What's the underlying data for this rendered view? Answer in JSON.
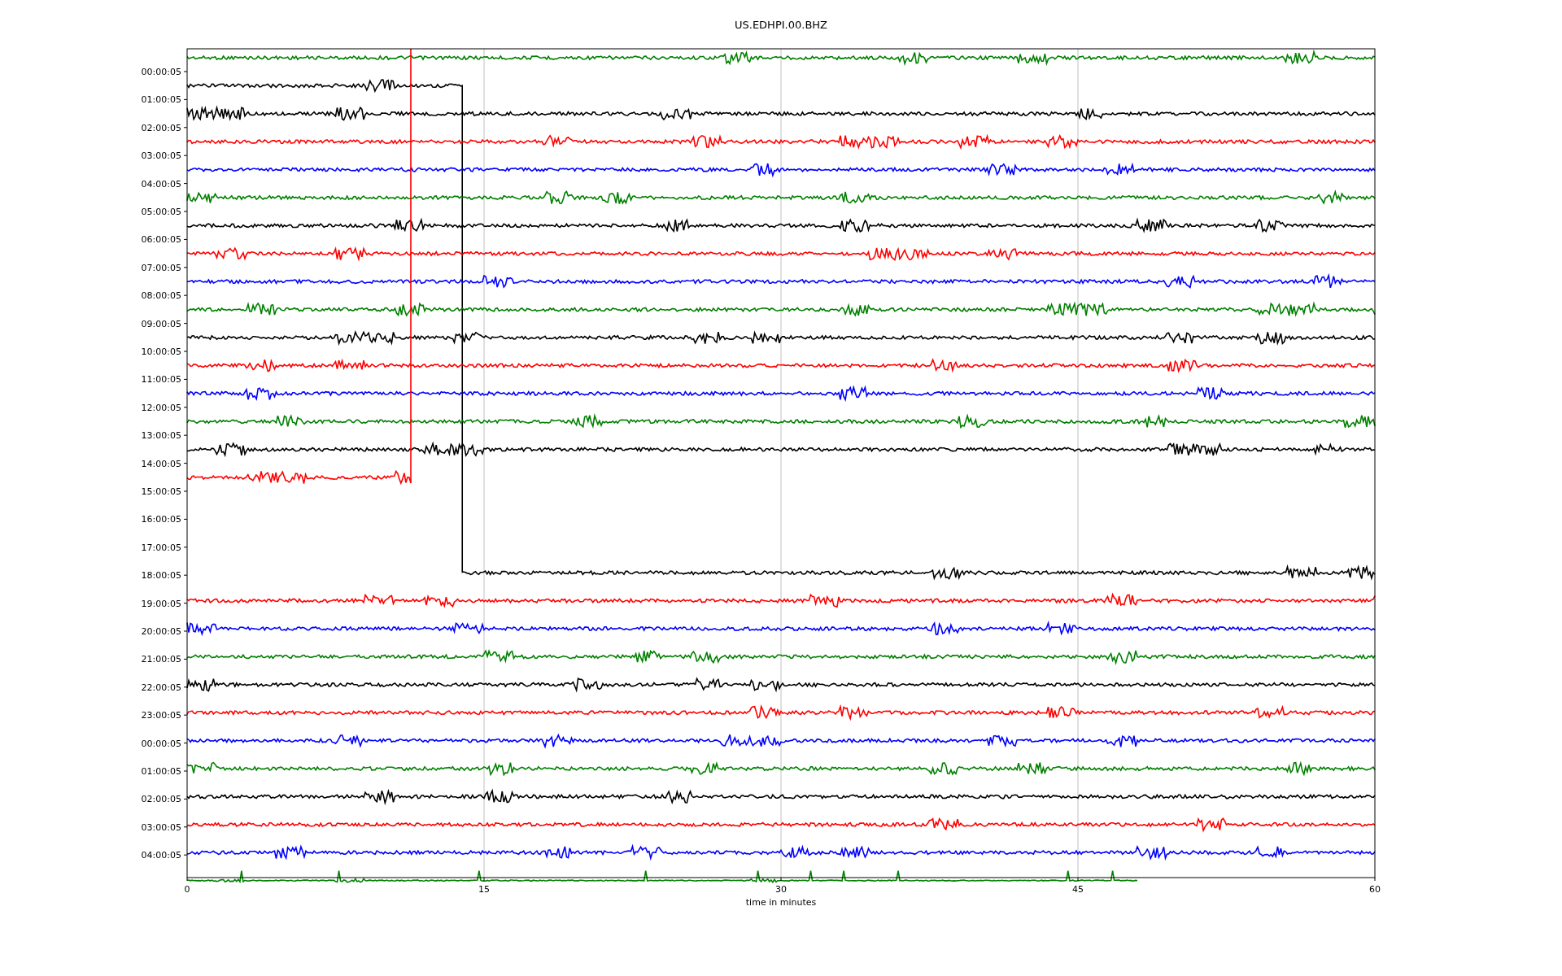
{
  "chart": {
    "title": "US.EDHPI.00.BHZ",
    "xlabel": "time in minutes",
    "xticks": [
      "0",
      "15",
      "30",
      "45",
      "60"
    ],
    "ytick_labels": [
      "00:00:05",
      "01:00:05",
      "02:00:05",
      "03:00:05",
      "04:00:05",
      "05:00:05",
      "06:00:05",
      "07:00:05",
      "08:00:05",
      "09:00:05",
      "10:00:05",
      "11:00:05",
      "12:00:05",
      "13:00:05",
      "14:00:05",
      "15:00:05",
      "16:00:05",
      "17:00:05",
      "18:00:05",
      "19:00:05",
      "20:00:05",
      "21:00:05",
      "22:00:05",
      "23:00:05",
      "00:00:05",
      "01:00:05",
      "02:00:05",
      "03:00:05",
      "04:00:05"
    ],
    "traces": [
      {
        "color": "#008000"
      },
      {
        "color": "#000000"
      },
      {
        "color": "#000000"
      },
      {
        "color": "#ff0000"
      },
      {
        "color": "#0000ff"
      },
      {
        "color": "#008000"
      },
      {
        "color": "#000000"
      },
      {
        "color": "#ff0000"
      },
      {
        "color": "#0000ff"
      },
      {
        "color": "#008000"
      },
      {
        "color": "#000000"
      },
      {
        "color": "#ff0000"
      },
      {
        "color": "#0000ff"
      },
      {
        "color": "#008000"
      },
      {
        "color": "#000000"
      },
      {
        "color": "#ff0000"
      },
      {
        "color": "#000000"
      },
      {
        "color": "#ff0000"
      },
      {
        "color": "#0000ff"
      },
      {
        "color": "#008000"
      },
      {
        "color": "#000000"
      },
      {
        "color": "#ff0000"
      },
      {
        "color": "#0000ff"
      },
      {
        "color": "#008000"
      },
      {
        "color": "#000000"
      },
      {
        "color": "#ff0000"
      },
      {
        "color": "#0000ff"
      },
      {
        "color": "#008000"
      }
    ]
  }
}
